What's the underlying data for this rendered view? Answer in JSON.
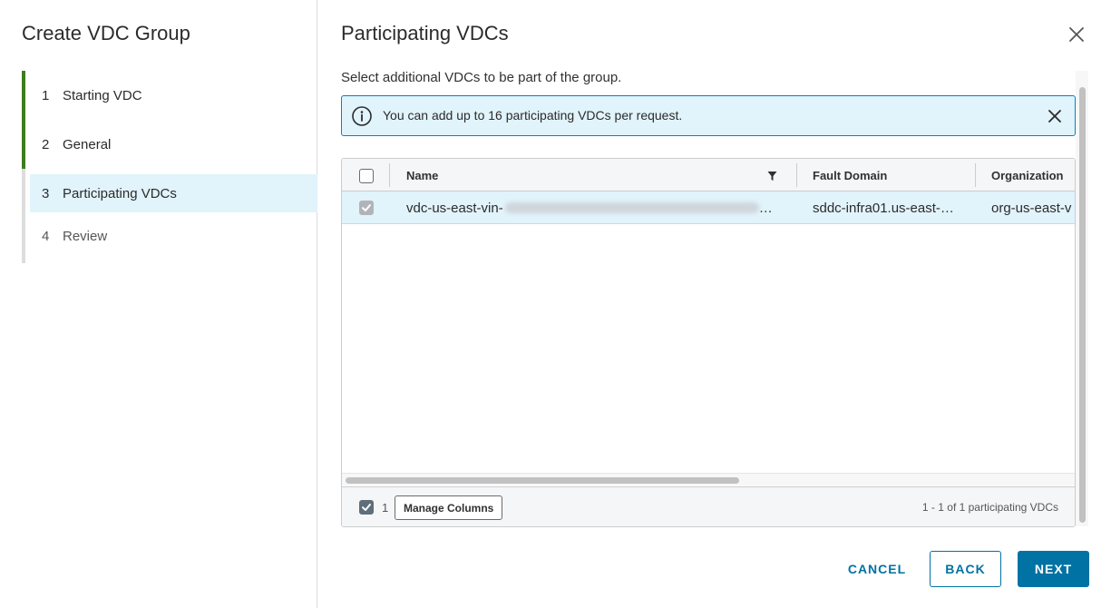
{
  "wizard": {
    "title": "Create VDC Group",
    "steps": [
      {
        "num": "1",
        "label": "Starting VDC"
      },
      {
        "num": "2",
        "label": "General"
      },
      {
        "num": "3",
        "label": "Participating VDCs"
      },
      {
        "num": "4",
        "label": "Review"
      }
    ]
  },
  "main": {
    "title": "Participating VDCs",
    "description": "Select additional VDCs to be part of the group.",
    "alert": "You can add up to 16 participating VDCs per request."
  },
  "grid": {
    "columns": [
      "Name",
      "Fault Domain",
      "Organization"
    ],
    "rows": [
      {
        "name": "vdc-us-east-vin-",
        "name_suffix": "…",
        "fault_domain": "sddc-infra01.us-east-…",
        "organization": "org-us-east-v"
      }
    ],
    "footer": {
      "selected_count": "1",
      "manage_columns": "Manage Columns",
      "pagination": "1 - 1 of 1 participating VDCs"
    }
  },
  "buttons": {
    "cancel": "CANCEL",
    "back": "BACK",
    "next": "NEXT"
  },
  "colors": {
    "completed_step": "#3e7d1f",
    "primary": "#0072a3",
    "selected_bg": "#e1f3fb"
  }
}
